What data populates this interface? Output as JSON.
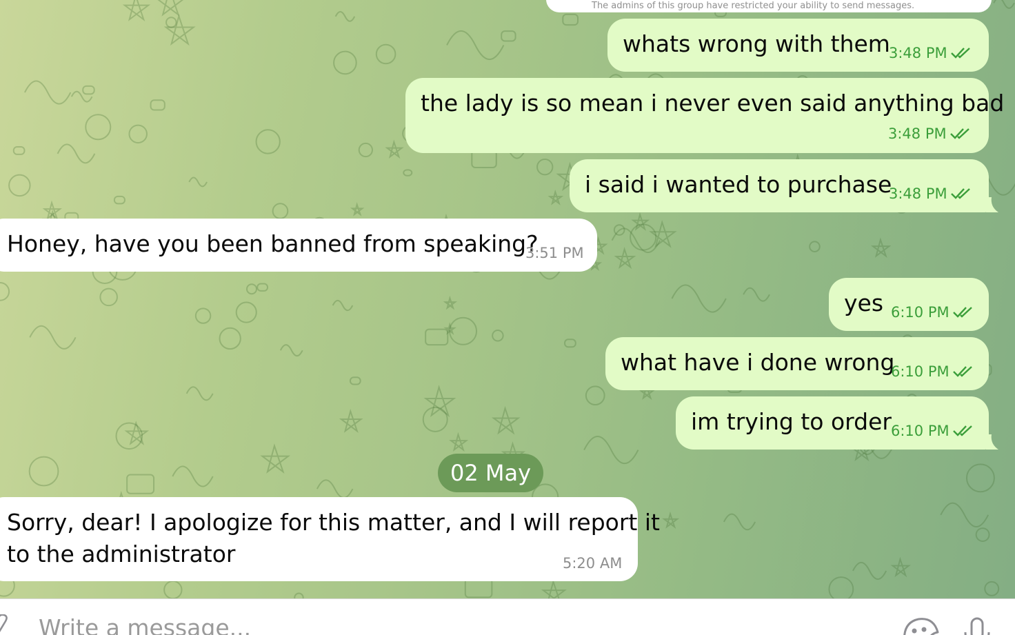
{
  "chat": {
    "restricted_notice": "The admins of this group have restricted your ability to send messages.",
    "messages": [
      {
        "direction": "outgoing",
        "text": "whats wrong with them",
        "time": "3:48 PM",
        "status": "read"
      },
      {
        "direction": "outgoing",
        "text": "the lady is so mean i never even said anything bad",
        "time": "3:48 PM",
        "status": "read"
      },
      {
        "direction": "outgoing",
        "text": "i said i wanted to purchase",
        "time": "3:48 PM",
        "status": "read"
      },
      {
        "direction": "incoming",
        "text": "Honey, have you been banned from speaking?",
        "time": "3:51 PM"
      },
      {
        "direction": "outgoing",
        "text": "yes",
        "time": "6:10 PM",
        "status": "read"
      },
      {
        "direction": "outgoing",
        "text": "what have i done wrong",
        "time": "6:10 PM",
        "status": "read"
      },
      {
        "direction": "outgoing",
        "text": "im trying to order",
        "time": "6:10 PM",
        "status": "read"
      },
      {
        "direction": "incoming",
        "text_line1": "Sorry, dear! I apologize for this matter, and I will report it",
        "text_line2": "to the administrator",
        "time": "5:20 AM"
      }
    ],
    "date_separator": "02 May"
  },
  "composer": {
    "placeholder": "Write a message...",
    "icons": [
      "attach-icon",
      "sticker-icon",
      "microphone-icon"
    ]
  },
  "colors": {
    "outgoing_bubble": "#e2fbc6",
    "incoming_bubble": "#ffffff",
    "outgoing_meta": "#3b9e3a",
    "incoming_meta": "#8d8d8d",
    "date_pill": "#6c9a58"
  }
}
